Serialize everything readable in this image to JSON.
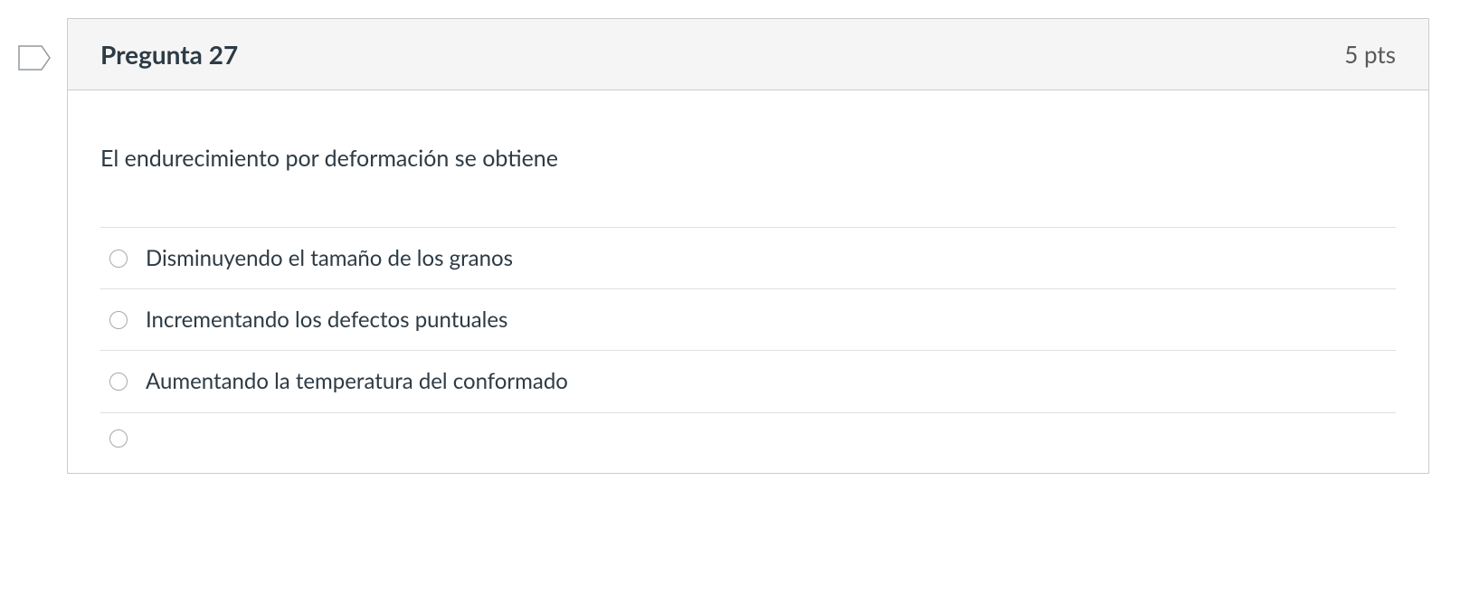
{
  "question": {
    "title": "Pregunta 27",
    "points": "5 pts",
    "text": "El endurecimiento por deformación se obtiene",
    "options": [
      {
        "label": "Disminuyendo el tamaño de los granos"
      },
      {
        "label": "Incrementando los defectos puntuales"
      },
      {
        "label": "Aumentando la temperatura del conformado"
      },
      {
        "label": ""
      }
    ]
  }
}
